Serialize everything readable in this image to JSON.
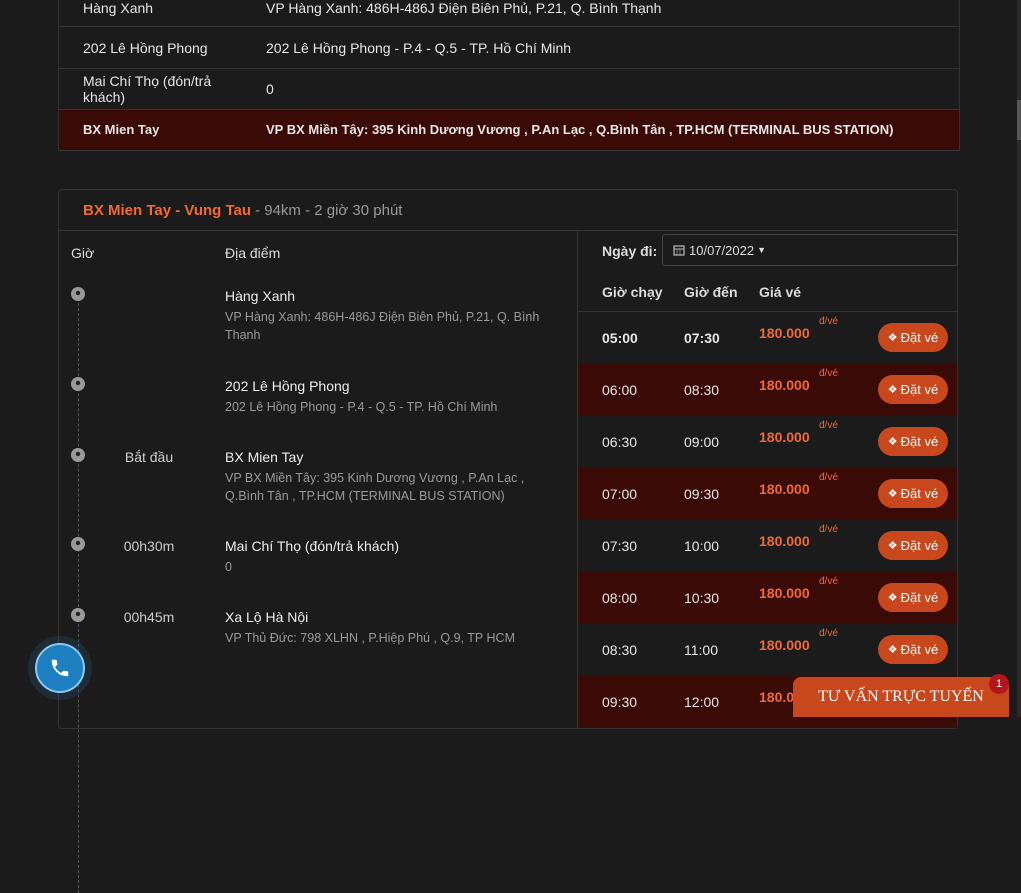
{
  "stops_table": [
    {
      "name": "Hàng Xanh",
      "address": "VP Hàng Xanh: 486H-486J Điện Biên Phủ, P.21, Q. Bình Thạnh"
    },
    {
      "name": "202 Lê Hồng Phong",
      "address": "202 Lê Hồng Phong - P.4 - Q.5 - TP. Hồ Chí Minh"
    },
    {
      "name": "Mai Chí Thọ (đón/trả khách)",
      "address": "0"
    },
    {
      "name": "BX Mien Tay",
      "address": "VP BX Miền Tây: 395 Kinh Dương Vương , P.An Lạc , Q.Bình Tân , TP.HCM (TERMINAL BUS STATION)"
    }
  ],
  "route": {
    "name": "BX Mien Tay - Vung Tau",
    "meta": "- 94km - 2 giờ 30 phút"
  },
  "itinerary": {
    "col_time": "Giờ",
    "col_place": "Địa điểm",
    "stops": [
      {
        "time": "",
        "name": "Hàng Xanh",
        "address": "VP Hàng Xanh: 486H-486J Điện Biên Phủ, P.21, Q. Bình Thạnh"
      },
      {
        "time": "",
        "name": "202 Lê Hồng Phong",
        "address": "202 Lê Hồng Phong - P.4 - Q.5 - TP. Hồ Chí Minh"
      },
      {
        "time": "Bắt đầu",
        "name": "BX Mien Tay",
        "address": "VP BX Miền Tây: 395 Kinh Dương Vương , P.An Lạc , Q.Bình Tân , TP.HCM (TERMINAL BUS STATION)"
      },
      {
        "time": "00h30m",
        "name": "Mai Chí Thọ (đón/trả khách)",
        "address": "0"
      },
      {
        "time": "00h45m",
        "name": "Xa Lộ Hà Nội",
        "address": "VP Thủ Đức: 798 XLHN , P.Hiệp Phú , Q.9, TP HCM"
      }
    ]
  },
  "schedule": {
    "date_label": "Ngày đi:",
    "date_value": "10/07/2022",
    "headers": {
      "dep": "Giờ chạy",
      "arr": "Giờ đến",
      "price": "Giá vé"
    },
    "price_unit": "đ/vé",
    "book_label": "Đặt vé",
    "trips": [
      {
        "dep": "05:00",
        "arr": "07:30",
        "price": "180.000"
      },
      {
        "dep": "06:00",
        "arr": "08:30",
        "price": "180.000"
      },
      {
        "dep": "06:30",
        "arr": "09:00",
        "price": "180.000"
      },
      {
        "dep": "07:00",
        "arr": "09:30",
        "price": "180.000"
      },
      {
        "dep": "07:30",
        "arr": "10:00",
        "price": "180.000"
      },
      {
        "dep": "08:00",
        "arr": "10:30",
        "price": "180.000"
      },
      {
        "dep": "08:30",
        "arr": "11:00",
        "price": "180.000"
      },
      {
        "dep": "09:30",
        "arr": "12:00",
        "price": "180.0"
      }
    ]
  },
  "chat": {
    "label": "TƯ VẤN TRỰC TUYẾN",
    "badge": "1"
  },
  "colors": {
    "accent": "#f26a34",
    "button": "#c8471c",
    "highlight_row": "#3a0a06",
    "background": "#1b1b1c"
  }
}
